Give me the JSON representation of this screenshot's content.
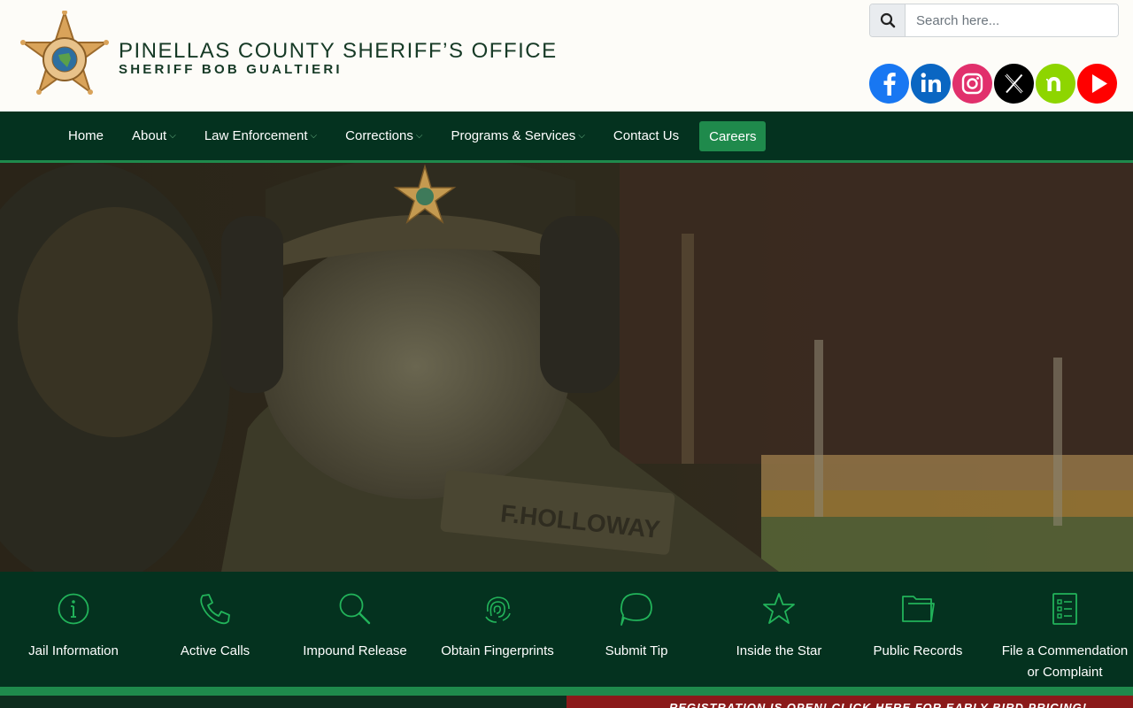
{
  "header": {
    "title": "PINELLAS COUNTY SHERIFF’S OFFICE",
    "subtitle": "SHERIFF BOB GUALTIERI"
  },
  "search": {
    "placeholder": "Search here..."
  },
  "social": [
    {
      "name": "facebook",
      "icon": "facebook-icon",
      "color": "#1877f2"
    },
    {
      "name": "linkedin",
      "icon": "linkedin-icon",
      "color": "#0a66c2"
    },
    {
      "name": "instagram",
      "icon": "instagram-icon",
      "color": "#e1306c"
    },
    {
      "name": "x",
      "icon": "x-icon",
      "color": "#000000"
    },
    {
      "name": "nextdoor",
      "icon": "nextdoor-icon",
      "color": "#8ed500"
    },
    {
      "name": "youtube",
      "icon": "youtube-icon",
      "color": "#ff0000"
    }
  ],
  "nav": {
    "items": [
      {
        "label": "Home"
      },
      {
        "label": "About"
      },
      {
        "label": "Law Enforcement"
      },
      {
        "label": "Corrections"
      },
      {
        "label": "Programs & Services"
      },
      {
        "label": "Contact Us"
      }
    ],
    "careers": "Careers"
  },
  "hero": {
    "nametag": "F.HOLLOWAY"
  },
  "quick_links": [
    {
      "label": "Jail Information",
      "icon": "info-icon"
    },
    {
      "label": "Active Calls",
      "icon": "phone-icon"
    },
    {
      "label": "Impound Release",
      "icon": "magnifier-icon"
    },
    {
      "label": "Obtain Fingerprints",
      "icon": "fingerprint-icon"
    },
    {
      "label": "Submit Tip",
      "icon": "chat-bubble-icon"
    },
    {
      "label": "Inside the Star",
      "icon": "star-icon"
    },
    {
      "label": "Public Records",
      "icon": "folder-icon"
    },
    {
      "label": "File a Commendation",
      "label2": "or Complaint",
      "icon": "checklist-icon"
    }
  ],
  "banner": {
    "text": "REGISTRATION IS OPEN! CLICK HERE FOR EARLY BIRD PRICING!"
  },
  "colors": {
    "dark_green": "#04321f",
    "accent_green": "#1f8a4c",
    "icon_green": "#22b35a"
  }
}
